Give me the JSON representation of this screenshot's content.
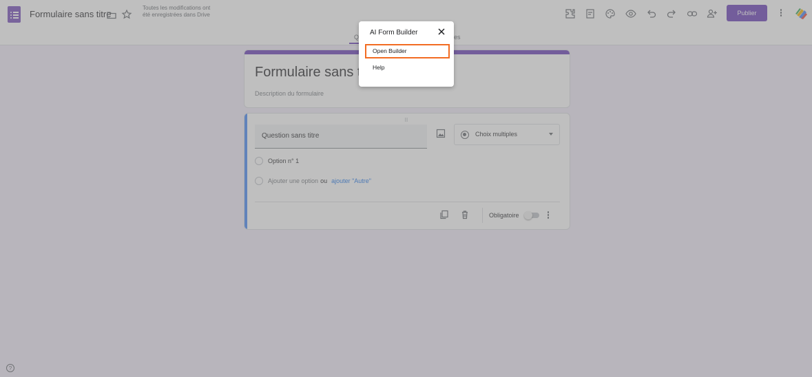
{
  "header": {
    "doc_title": "Formulaire sans titre",
    "save_status": "Toutes les modifications ont été enregistrées dans Drive",
    "publish_label": "Publier",
    "toolbar_icons": [
      "customize-icon",
      "template-icon",
      "palette-icon",
      "preview-icon",
      "undo-icon",
      "redo-icon",
      "link-icon",
      "add-person-icon",
      "more-vert-icon"
    ],
    "tabs": {
      "left_partial": "Q",
      "right_partial": "es"
    }
  },
  "form": {
    "title": "Formulaire sans titre",
    "description": "Description du formulaire",
    "question": {
      "title_placeholder": "Question sans titre",
      "type": "Choix multiples",
      "options": [
        "Option n° 1"
      ],
      "add_option": "Ajouter une option",
      "or": "ou",
      "add_other": "ajouter \"Autre\"",
      "required_label": "Obligatoire"
    }
  },
  "modal": {
    "title": "AI Form Builder",
    "items": [
      "Open Builder",
      "Help"
    ]
  },
  "colors": {
    "accent": "#673ab7",
    "highlight": "#f26b21",
    "question_active": "#4285f4"
  }
}
